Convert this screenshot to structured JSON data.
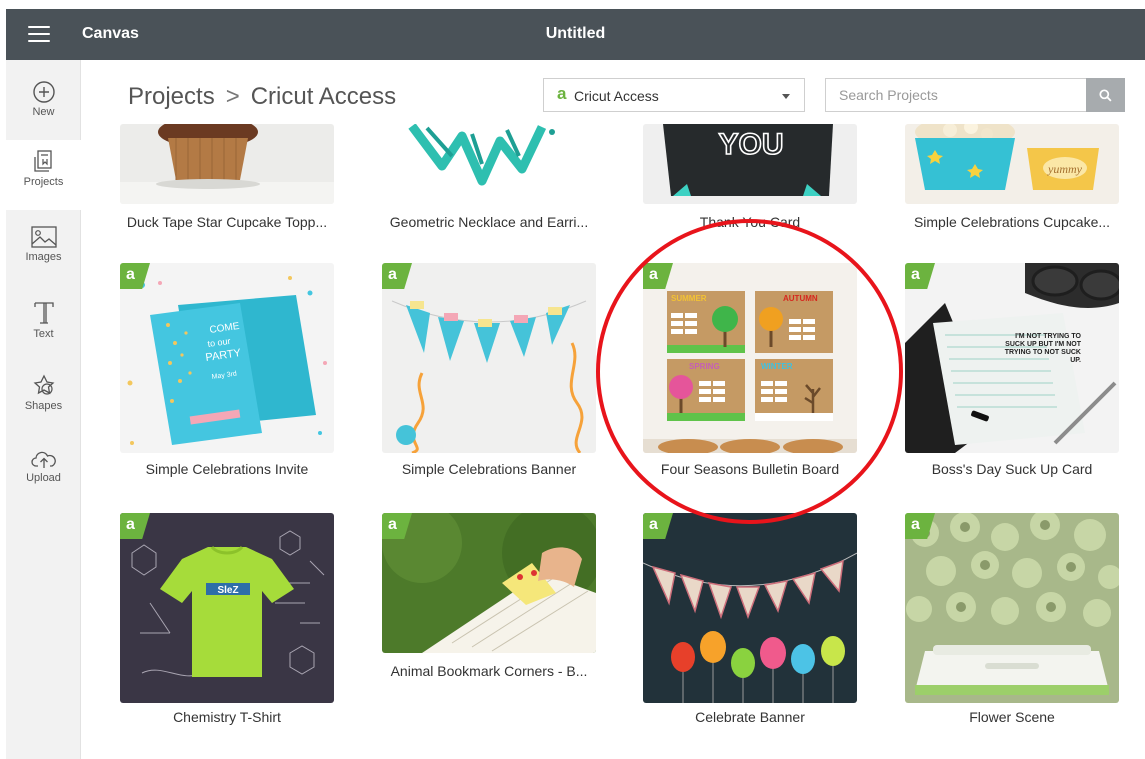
{
  "topbar": {
    "app_name": "Canvas",
    "doc_title": "Untitled"
  },
  "sidebar": {
    "items": [
      {
        "label": "New",
        "icon": "plus-circle-icon"
      },
      {
        "label": "Projects",
        "icon": "projects-icon"
      },
      {
        "label": "Images",
        "icon": "image-icon"
      },
      {
        "label": "Text",
        "icon": "text-icon"
      },
      {
        "label": "Shapes",
        "icon": "shapes-icon"
      },
      {
        "label": "Upload",
        "icon": "upload-icon"
      }
    ]
  },
  "breadcrumb": {
    "root": "Projects",
    "separator": ">",
    "current": "Cricut Access"
  },
  "filter": {
    "badge": "a",
    "selected": "Cricut Access"
  },
  "search": {
    "placeholder": "Search Projects",
    "value": ""
  },
  "access_badge": "a",
  "colors": {
    "accent_green": "#6cb33f",
    "topbar": "#4a5258",
    "annotation_red": "#e8141b"
  },
  "rows": [
    {
      "cards": [
        {
          "title": "Duck Tape Star Cupcake Topp...",
          "access": false
        },
        {
          "title": "Geometric Necklace and Earri...",
          "access": false
        },
        {
          "title": "Thank You Card",
          "access": false,
          "thumb_text": "YOU"
        },
        {
          "title": "Simple Celebrations Cupcake...",
          "access": false
        }
      ]
    },
    {
      "cards": [
        {
          "title": "Simple Celebrations Invite",
          "access": true
        },
        {
          "title": "Simple Celebrations Banner",
          "access": true
        },
        {
          "title": "Four Seasons Bulletin Board",
          "access": true,
          "seasons": [
            "SUMMER",
            "AUTUMN",
            "SPRING",
            "WINTER"
          ]
        },
        {
          "title": "Boss's Day Suck Up Card",
          "access": true,
          "thumb_text": "I'M NOT TRYING TO SUCK UP BUT I'M NOT TRYING TO NOT SUCK UP."
        }
      ]
    },
    {
      "cards": [
        {
          "title": "Chemistry T-Shirt",
          "access": true
        },
        {
          "title": "Animal Bookmark Corners - B...",
          "access": true
        },
        {
          "title": "Celebrate Banner",
          "access": true
        },
        {
          "title": "Flower Scene",
          "access": true
        }
      ]
    }
  ]
}
